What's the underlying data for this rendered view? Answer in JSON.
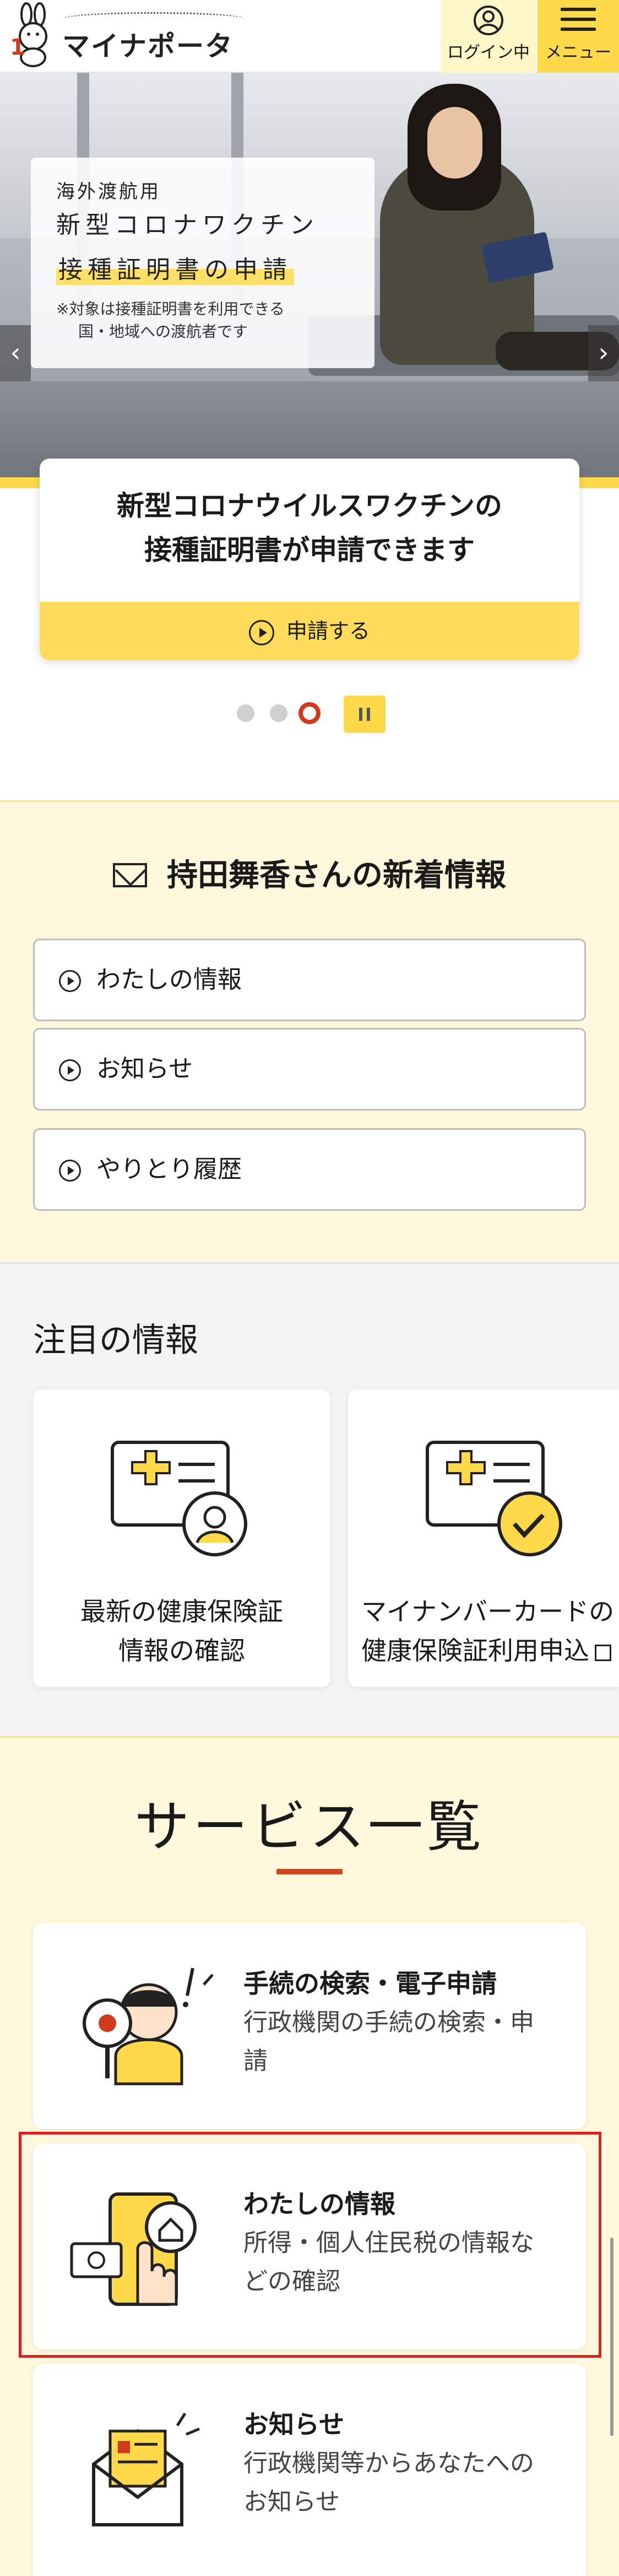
{
  "header": {
    "logo_text": "マイナポータル",
    "login_label": "ログイン中",
    "menu_label": "メニュー"
  },
  "hero": {
    "kicker": "海外渡航用",
    "line1": "新型コロナワクチン",
    "line2": "接種証明書の申請",
    "note_line1": "※対象は接種証明書を利用できる",
    "note_line2": "国・地域への渡航者です",
    "panel_title_line1": "新型コロナウイルスワクチンの",
    "panel_title_line2": "接種証明書が申請できます",
    "apply_label": "申請する",
    "slides": {
      "count": 3,
      "active": 3
    }
  },
  "news": {
    "title": "持田舞香さんの新着情報",
    "buttons": [
      "わたしの情報",
      "お知らせ",
      "やりとり履歴"
    ]
  },
  "attention": {
    "title": "注目の情報",
    "cards": [
      {
        "line1": "最新の健康保険証",
        "line2": "情報の確認"
      },
      {
        "line1": "マイナンバーカードの",
        "line2": "健康保険証利用申込"
      }
    ]
  },
  "services": {
    "title": "サービス一覧",
    "items": [
      {
        "title": "手続の検索・電子申請",
        "desc": "行政機関の手続の検索・申請"
      },
      {
        "title": "わたしの情報",
        "desc": "所得・個人住民税の情報などの確認"
      },
      {
        "title": "お知らせ",
        "desc": "行政機関等からあなたへのお知らせ"
      }
    ]
  },
  "colors": {
    "brand_yellow": "#ffd94a",
    "cream": "#fff8dc",
    "accent_red": "#d0471f",
    "highlight_red": "#e01e1e"
  }
}
